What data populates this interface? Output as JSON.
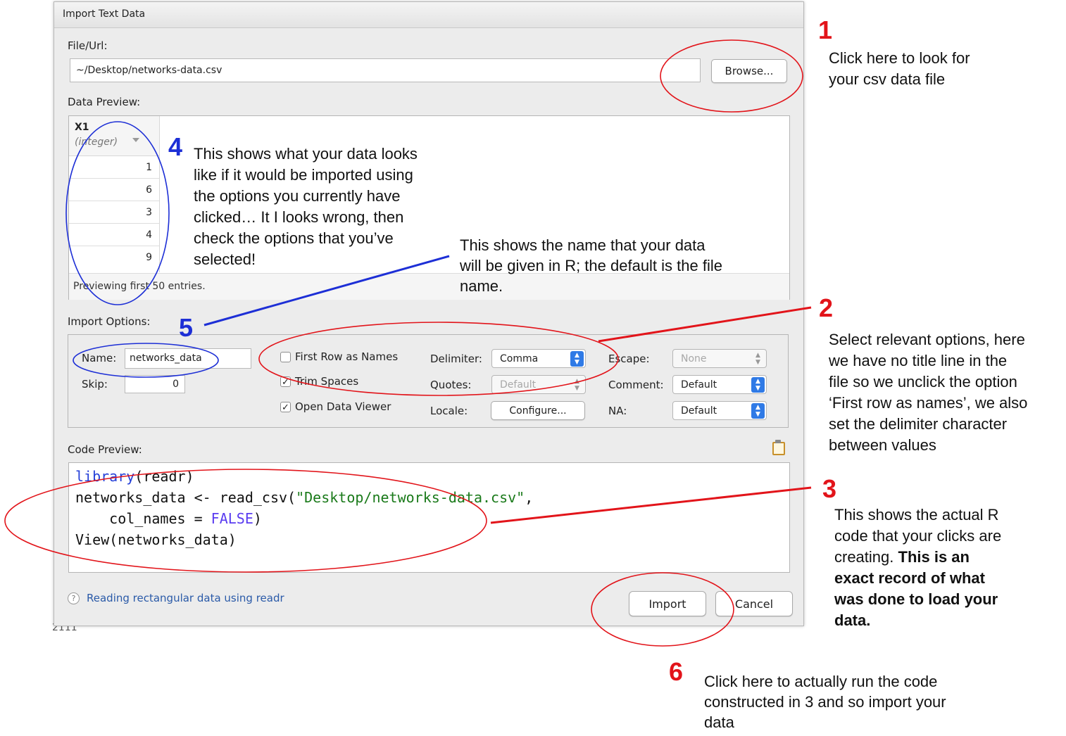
{
  "dialog": {
    "title": "Import Text Data",
    "file_url_label": "File/Url:",
    "file_url_value": "~/Desktop/networks-data.csv",
    "browse_label": "Browse...",
    "data_preview_label": "Data Preview:",
    "column": {
      "name": "X1",
      "type": "(integer)"
    },
    "rows": [
      "1",
      "6",
      "3",
      "4",
      "9"
    ],
    "preview_status": "Previewing first 50 entries.",
    "import_options_label": "Import Options:",
    "name_label": "Name:",
    "name_value": "networks_data",
    "skip_label": "Skip:",
    "skip_value": "0",
    "first_row_label": "First Row as Names",
    "trim_spaces_label": "Trim Spaces",
    "open_viewer_label": "Open Data Viewer",
    "delimiter_label": "Delimiter:",
    "delimiter_value": "Comma",
    "quotes_label": "Quotes:",
    "quotes_value": "Default",
    "locale_label": "Locale:",
    "configure_label": "Configure...",
    "escape_label": "Escape:",
    "escape_value": "None",
    "comment_label": "Comment:",
    "comment_value": "Default",
    "na_label": "NA:",
    "na_value": "Default",
    "code_preview_label": "Code Preview:",
    "code": {
      "l1_fn": "library",
      "l1_rest": "(readr)",
      "l2_a": "networks_data <- read_csv(",
      "l2_str": "\"Desktop/networks-data.csv\"",
      "l2_b": ",",
      "l3_a": "    col_names = ",
      "l3_false": "FALSE",
      "l3_b": ")",
      "l4": "View(networks_data)"
    },
    "help_link": "Reading rectangular data using readr",
    "import_label": "Import",
    "cancel_label": "Cancel"
  },
  "background_text": "2111",
  "annotations": {
    "n1": "1",
    "n1_text": [
      "Click here to look for",
      "your csv data file"
    ],
    "n2": "2",
    "n2_text": [
      "Select relevant options, here",
      "we have no title line in the",
      "file so we unclick the option",
      "‘First row as names’, we also",
      "set the delimiter character",
      "between values"
    ],
    "n3": "3",
    "n3_text": [
      "This shows the actual R",
      "code that your clicks are",
      "creating. "
    ],
    "n3_bold": [
      "This is an",
      "exact record of what",
      "was done to load your",
      "data."
    ],
    "n4": "4",
    "n4_text": [
      "This shows what your data looks",
      "like if it would be imported using",
      "the options you currently have",
      "clicked… It I looks wrong, then",
      "check the options that you’ve",
      "selected!"
    ],
    "n5": "5",
    "n5_text": [
      "This shows the name that your data",
      "will be given in R; the default is the file",
      "name."
    ],
    "n6": "6",
    "n6_text": [
      "Click here to actually run the code",
      "constructed in 3 and so import your",
      "data"
    ]
  },
  "colors": {
    "annotation_red": "#e2141a",
    "annotation_blue": "#1d2fd6",
    "accent": "#2f7ae6"
  }
}
